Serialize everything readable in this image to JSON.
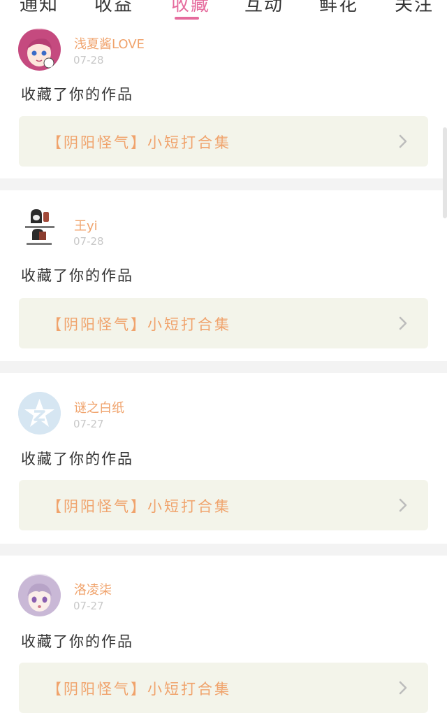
{
  "tabs": [
    {
      "label": "通知",
      "active": false
    },
    {
      "label": "收益",
      "active": false
    },
    {
      "label": "收藏",
      "active": true
    },
    {
      "label": "互动",
      "active": false
    },
    {
      "label": "鲜花",
      "active": false
    },
    {
      "label": "关注",
      "active": false
    }
  ],
  "colors": {
    "accent_pink": "#e56b9d",
    "username_orange": "#f0a36c",
    "work_box_bg": "#f3f4ea",
    "separator": "#f3f3f3"
  },
  "notifications": [
    {
      "user": "浅夏酱LOVE",
      "date": "07-28",
      "action": "收藏了你的作品",
      "work_title": "【阴阳怪气】小短打合集",
      "avatar_icon": "anime-girl-avatar-icon"
    },
    {
      "user": "王yi",
      "date": "07-28",
      "action": "收藏了你的作品",
      "work_title": "【阴阳怪气】小短打合集",
      "avatar_icon": "meme-avatar-icon"
    },
    {
      "user": "谜之白纸",
      "date": "07-27",
      "action": "收藏了你的作品",
      "work_title": "【阴阳怪气】小短打合集",
      "avatar_icon": "default-star-avatar-icon"
    },
    {
      "user": "洛凌柒",
      "date": "07-27",
      "action": "收藏了你的作品",
      "work_title": "【阴阳怪气】小短打合集",
      "avatar_icon": "anime-girl-avatar-icon"
    }
  ]
}
